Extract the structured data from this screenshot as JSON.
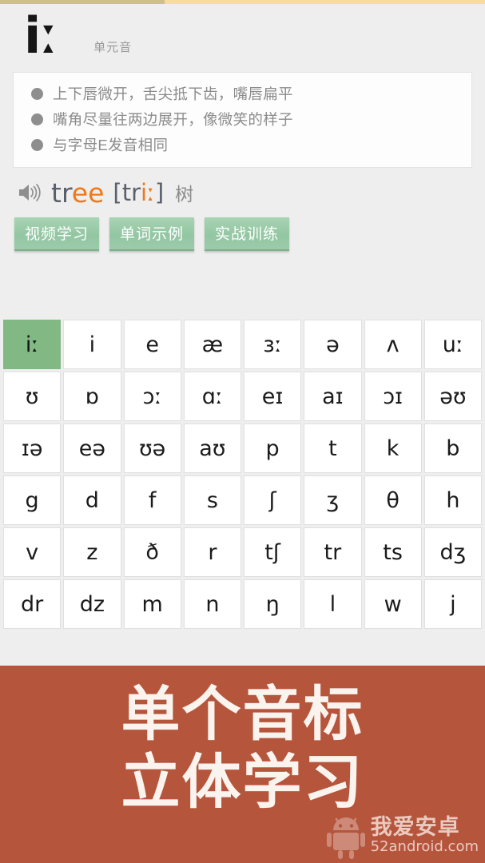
{
  "top_bar": {
    "name": "progress-bar",
    "fill_percent": 34,
    "fill_color": "#cfc08a",
    "track_color": "#f6dd9e"
  },
  "header": {
    "symbol": "iː",
    "category_label": "单元音"
  },
  "description": {
    "bullets": [
      "上下唇微开，舌尖抵下齿，嘴唇扁平",
      "嘴角尽量往两边展开，像微笑的样子",
      "与字母E发音相同"
    ]
  },
  "example": {
    "speaker_icon": "speaker-icon",
    "word_prefix": "tr",
    "word_accent": "ee",
    "ipa_open": "[tr",
    "ipa_accent": "iː",
    "ipa_close": "]",
    "meaning": "树",
    "accent_color": "#f07818",
    "text_color": "#5a5f6b"
  },
  "actions": {
    "buttons": [
      {
        "label": "视频学习",
        "name": "video-study-button"
      },
      {
        "label": "单词示例",
        "name": "word-example-button"
      },
      {
        "label": "实战训练",
        "name": "practice-training-button"
      }
    ],
    "button_color": "#93c6a2"
  },
  "ipa_grid": {
    "selected": "iː",
    "selected_color": "#82b884",
    "rows": [
      [
        "iː",
        "i",
        "e",
        "æ",
        "ɜː",
        "ə",
        "ʌ",
        "uː"
      ],
      [
        "ʊ",
        "ɒ",
        "ɔː",
        "ɑː",
        "eɪ",
        "aɪ",
        "ɔɪ",
        "əʊ"
      ],
      [
        "ɪə",
        "eə",
        "ʊə",
        "aʊ",
        "p",
        "t",
        "k",
        "b"
      ],
      [
        "g",
        "d",
        "f",
        "s",
        "ʃ",
        "ʒ",
        "θ",
        "h"
      ],
      [
        "v",
        "z",
        "ð",
        "r",
        "tʃ",
        "tr",
        "ts",
        "dʒ"
      ],
      [
        "dr",
        "dz",
        "m",
        "n",
        "ŋ",
        "l",
        "w",
        "j"
      ]
    ]
  },
  "banner": {
    "line1": "单个音标",
    "line2": "立体学习",
    "background_color": "#b5553c",
    "text_color": "#fbf3ee"
  },
  "watermark": {
    "site_name": "我爱安卓",
    "url": "52android.com",
    "logo": "android-robot-icon"
  }
}
